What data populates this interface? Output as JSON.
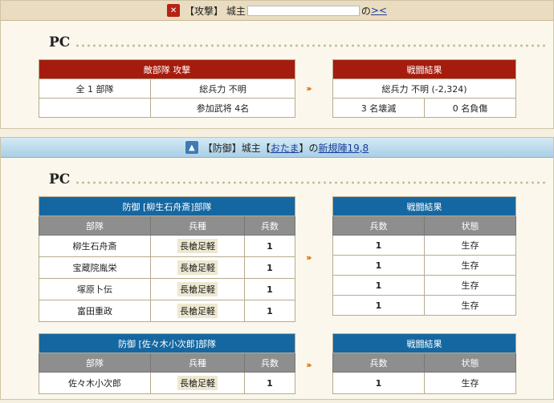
{
  "attack": {
    "title_prefix": "【攻撃】 城主",
    "title_suffix": "の",
    "title_link": "><",
    "pc": "PC",
    "enemy": {
      "header": "敵部隊  攻撃",
      "row1": [
        "全 1 部隊",
        "総兵力 不明"
      ],
      "row2": [
        "",
        "参加武将 4名"
      ]
    },
    "result": {
      "header": "戦闘結果",
      "row1": "総兵力 不明 (-2,324)",
      "row2": [
        "3 名壊滅",
        "0 名負傷"
      ]
    }
  },
  "defense": {
    "title_prefix": "【防御】城主【",
    "title_lord": "おたま",
    "title_mid": "】の",
    "title_link": "新規陣19,8",
    "pc": "PC",
    "units": [
      {
        "header": "防御  [柳生石舟斎]部隊",
        "cols": [
          "部隊",
          "兵種",
          "兵数"
        ],
        "rows": [
          [
            "柳生石舟斎",
            "長槍足軽",
            "1"
          ],
          [
            "宝蔵院胤栄",
            "長槍足軽",
            "1"
          ],
          [
            "塚原卜伝",
            "長槍足軽",
            "1"
          ],
          [
            "富田重政",
            "長槍足軽",
            "1"
          ]
        ],
        "result_header": "戦闘結果",
        "result_cols": [
          "兵数",
          "状態"
        ],
        "result_rows": [
          [
            "1",
            "生存"
          ],
          [
            "1",
            "生存"
          ],
          [
            "1",
            "生存"
          ],
          [
            "1",
            "生存"
          ]
        ]
      },
      {
        "header": "防御  [佐々木小次郎]部隊",
        "cols": [
          "部隊",
          "兵種",
          "兵数"
        ],
        "rows": [
          [
            "佐々木小次郎",
            "長槍足軽",
            "1"
          ]
        ],
        "result_header": "戦闘結果",
        "result_cols": [
          "兵数",
          "状態"
        ],
        "result_rows": [
          [
            "1",
            "生存"
          ]
        ]
      }
    ]
  }
}
